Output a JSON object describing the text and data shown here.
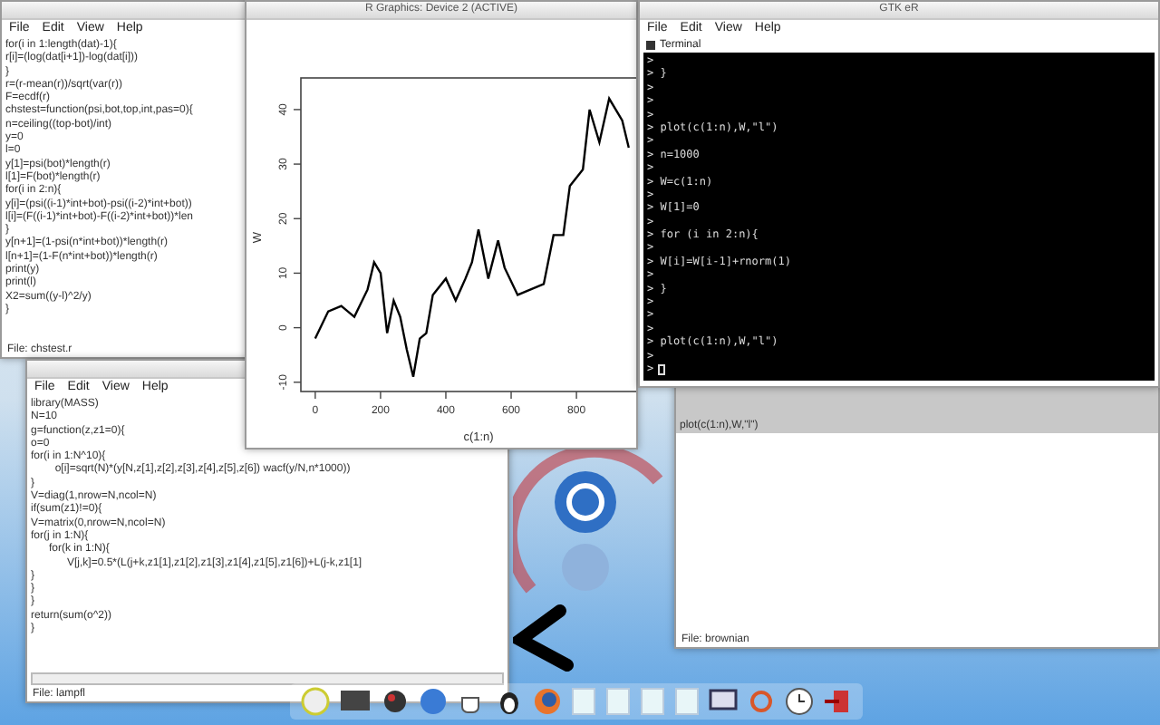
{
  "editor_top": {
    "menu": [
      "File",
      "Edit",
      "View",
      "Help"
    ],
    "lines": [
      "for(i in 1:length(dat)-1){",
      "r[i]=(log(dat[i+1])-log(dat[i]))",
      "}",
      "r=(r-mean(r))/sqrt(var(r))",
      "F=ecdf(r)",
      "chstest=function(psi,bot,top,int,pas=0){",
      "n=ceiling((top-bot)/int)",
      "y=0",
      "l=0",
      "y[1]=psi(bot)*length(r)",
      "l[1]=F(bot)*length(r)",
      "for(i in 2:n){",
      "y[i]=(psi((i-1)*int+bot)-psi((i-2)*int+bot))",
      "l[i]=(F((i-1)*int+bot)-F((i-2)*int+bot))*len",
      "}",
      "y[n+1]=(1-psi(n*int+bot))*length(r)",
      "l[n+1]=(1-F(n*int+bot))*length(r)",
      "print(y)",
      "print(l)",
      "X2=sum((y-l)^2/y)",
      "}"
    ],
    "status": "File: chstest.r"
  },
  "graphics_window": {
    "title": "R Graphics: Device 2 (ACTIVE)",
    "chart_data": {
      "type": "line",
      "xlabel": "c(1:n)",
      "ylabel": "W",
      "x": [
        0,
        40,
        80,
        100,
        120,
        160,
        180,
        200,
        220,
        240,
        260,
        280,
        300,
        320,
        340,
        360,
        400,
        430,
        460,
        480,
        500,
        530,
        560,
        580,
        620,
        660,
        700,
        730,
        760,
        780,
        820,
        840,
        870,
        900,
        940,
        960
      ],
      "series": [
        {
          "color": "#000000",
          "values": [
            -2,
            3,
            4,
            3,
            2,
            7,
            12,
            10,
            -1,
            5,
            2,
            -4,
            -9,
            -2,
            -1,
            6,
            9,
            5,
            9,
            12,
            18,
            9,
            16,
            11,
            6,
            7,
            8,
            17,
            17,
            26,
            29,
            40,
            34,
            42,
            38,
            33
          ]
        }
      ],
      "xlim": [
        -44,
        1044
      ],
      "ylim": [
        -11.7,
        45.8
      ],
      "xticks": [
        0,
        200,
        400,
        600,
        800
      ],
      "yticks": [
        -10,
        0,
        10,
        20,
        30,
        40
      ]
    }
  },
  "terminal_window": {
    "title": "GTK eR",
    "menu": [
      "File",
      "Edit",
      "View",
      "Help"
    ],
    "tab": "Terminal",
    "lines": [
      ">",
      "> }",
      ">",
      ">",
      ">",
      "> plot(c(1:n),W,\"l\")",
      ">",
      "> n=1000",
      ">",
      "> W=c(1:n)",
      ">",
      "> W[1]=0",
      ">",
      "> for (i in 2:n){",
      ">",
      "> W[i]=W[i-1]+rnorm(1)",
      ">",
      "> }",
      ">",
      ">",
      ">",
      "> plot(c(1:n),W,\"l\")",
      ">",
      ">"
    ]
  },
  "editor_bottom": {
    "menu": [
      "File",
      "Edit",
      "View",
      "Help"
    ],
    "lines": [
      "library(MASS)",
      "N=10",
      "g=function(z,z1=0){",
      "o=0",
      "for(i in 1:N^10){",
      "        o[i]=sqrt(N)*(y[N,z[1],z[2],z[3],z[4],z[5],z[6]) wacf(y/N,n*1000))",
      "}",
      "V=diag(1,nrow=N,ncol=N)",
      "if(sum(z1)!=0){",
      "V=matrix(0,nrow=N,ncol=N)",
      "for(j in 1:N){",
      "      for(k in 1:N){",
      "            V[j,k]=0.5*(L(j+k,z1[1],z1[2],z1[3],z1[4],z1[5],z1[6])+L(j-k,z1[1]",
      "}",
      "}",
      "}",
      "return(sum(o^2))",
      "}"
    ],
    "status": "File: lampfl"
  },
  "editor_back": {
    "lines": [
      "plot(c(1:n),W,\"l\")"
    ],
    "status": "File: brownian"
  }
}
